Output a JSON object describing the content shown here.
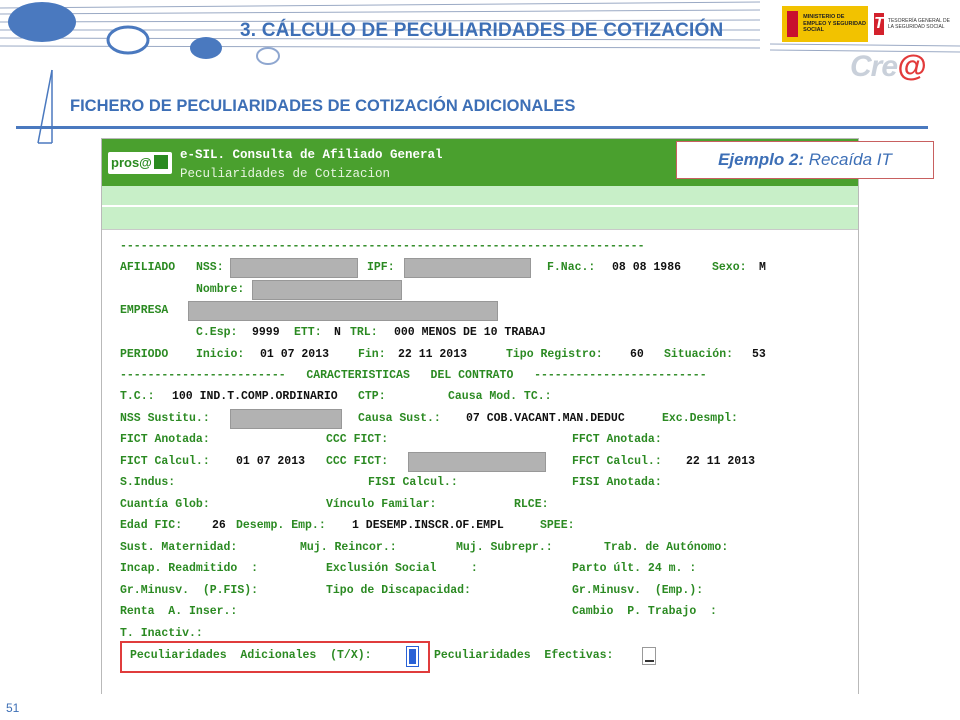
{
  "slide": {
    "title": "3. CÁLCULO DE PECULIARIDADES DE COTIZACIÓN",
    "subtitle": "FICHERO DE PECULIARIDADES DE COTIZACIÓN ADICIONALES",
    "page_number": "51",
    "logos": {
      "ministerio": "MINISTERIO DE EMPLEO Y SEGURIDAD SOCIAL",
      "tgss": "TESORERÍA GENERAL DE LA SEGURIDAD SOCIAL",
      "cret_a": "Cre",
      "cret_b": "@"
    },
    "example_badge": {
      "label": "Ejemplo 2:",
      "text": " Recaída IT"
    }
  },
  "app": {
    "logo_text": "pros@",
    "name": "e-SIL. Consulta de Afiliado General",
    "section": "Peculiaridades de Cotizacion"
  },
  "terminal": {
    "rule_top": "----------------------------------------------------------------------------",
    "afiliado": {
      "label": "AFILIADO",
      "nss_label": "NSS:",
      "ipf_label": "IPF:",
      "fnac_label": "F.Nac.:",
      "fnac": "08 08 1986",
      "sexo_label": "Sexo:",
      "sexo": "M"
    },
    "nombre_label": "Nombre:",
    "empresa_label": "EMPRESA",
    "cesp": {
      "label": "C.Esp:",
      "value": "9999",
      "ett_label": "ETT:",
      "ett": "N",
      "trl_label": "TRL:",
      "trl": "000 MENOS DE 10 TRABAJ"
    },
    "periodo": {
      "label": "PERIODO",
      "inicio_label": "Inicio:",
      "inicio": "01 07 2013",
      "fin_label": "Fin:",
      "fin": "22 11 2013",
      "tipo_label": "Tipo Registro:",
      "tipo": "60",
      "sit_label": "Situación:",
      "sit": "53"
    },
    "caracteristicas": "------------------------   CARACTERISTICAS   DEL CONTRATO   -------------------------",
    "tc": {
      "label": "T.C.:",
      "value": "100 IND.T.COMP.ORDINARIO",
      "ctp_label": "CTP:",
      "causa_label": "Causa Mod. TC.:"
    },
    "nss_sust": {
      "label": "NSS Sustitu.:",
      "causa_label": "Causa Sust.:",
      "causa": "07 COB.VACANT.MAN.DEDUC",
      "exc_label": "Exc.Desmpl:"
    },
    "fict_anot": {
      "label": "FICT Anotada:",
      "ccc_label": "CCC FICT:",
      "ffct_label": "FFCT Anotada:"
    },
    "fict_calc": {
      "label": "FICT Calcul.:",
      "value": "01 07 2013",
      "ccc_label": "CCC FICT:",
      "ffct_label": "FFCT Calcul.:",
      "ffct": "22 11 2013"
    },
    "sindus": {
      "label": "S.Indus:",
      "fisi_calc": "FISI Calcul.:",
      "fisi_anot": "FISI Anotada:"
    },
    "cuantia": {
      "label": "Cuantía Glob:",
      "vinc": "Vínculo Familar:",
      "rlce": "RLCE:"
    },
    "edad": {
      "label": "Edad FIC:",
      "value": "26",
      "desemp_label": "Desemp. Emp.:",
      "desemp": "1 DESEMP.INSCR.OF.EMPL",
      "spee": "SPEE:"
    },
    "sust": {
      "label": "Sust. Maternidad:",
      "muj1": "Muj. Reincor.:",
      "muj2": "Muj. Subrepr.:",
      "trab": "Trab. de Autónomo:"
    },
    "incap": {
      "label": "Incap. Readmitido  :",
      "excl": "Exclusión Social     :",
      "parto": "Parto últ. 24 m. :"
    },
    "minusv": {
      "label": "Gr.Minusv.  (P.FIS):",
      "tipo": "Tipo de Discapacidad:",
      "emp": "Gr.Minusv.  (Emp.):"
    },
    "renta": {
      "label": "Renta  A. Inser.:",
      "cambio": "Cambio  P. Trabajo  :"
    },
    "tinact": "T. Inactiv.:",
    "adicionales_label": "Peculiaridades  Adicionales  (T/X):",
    "efectivas_label": "Peculiaridades  Efectivas:"
  },
  "colors": {
    "accent_blue": "#3d6fb6",
    "header_green": "#4aa02e",
    "term_green": "#2b8a22",
    "highlight_red": "#e03c3c"
  }
}
